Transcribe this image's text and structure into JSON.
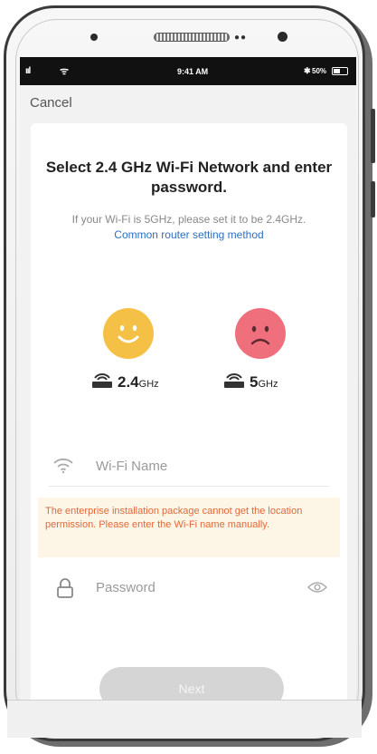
{
  "status_bar": {
    "signal": "ııl",
    "wifi": "ᯤ",
    "time": "9:41 AM",
    "bluetooth": "✱",
    "battery_text": "50%",
    "battery_level": 0.5
  },
  "nav": {
    "cancel_label": "Cancel"
  },
  "content": {
    "title": "Select 2.4 GHz Wi-Fi Network and enter password.",
    "subtitle_text": "If your Wi-Fi is 5GHz, please set it to be 2.4GHz.",
    "subtitle_link": "Common router setting method"
  },
  "bands": [
    {
      "value": "2.4",
      "unit": "GHz",
      "face": "happy",
      "color": "#f5c046"
    },
    {
      "value": "5",
      "unit": "GHz",
      "face": "sad",
      "color": "#ef6f7c"
    }
  ],
  "form": {
    "wifi_name_placeholder": "Wi-Fi Name",
    "warning": "The enterprise installation package cannot get the location permission. Please enter the Wi-Fi name manually.",
    "password_placeholder": "Password",
    "next_label": "Next"
  },
  "colors": {
    "link": "#2f6fbf",
    "warning_text": "#e0683b",
    "warning_bg": "#fdf6e6",
    "button_disabled": "#d5d5d5"
  }
}
